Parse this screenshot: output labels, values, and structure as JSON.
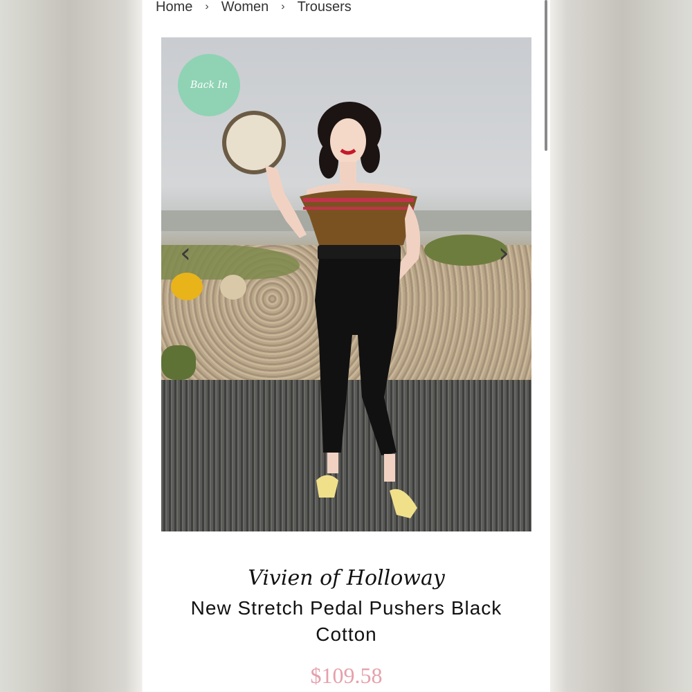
{
  "breadcrumb": {
    "items": [
      "Home",
      "Women",
      "Trousers"
    ],
    "separator": "›"
  },
  "product_image": {
    "badge_label": "Back In",
    "prev_arrow": "‹",
    "next_arrow": "›",
    "badge_color": "#8fd3b4"
  },
  "product": {
    "brand": "Vivien of Holloway",
    "title": "New Stretch Pedal Pushers Black Cotton",
    "price": "$109.58",
    "price_color": "#e6a0ab"
  }
}
